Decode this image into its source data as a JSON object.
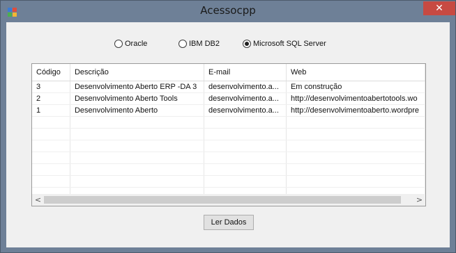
{
  "window": {
    "title": "Acessocpp",
    "close_glyph": "✕"
  },
  "db_options": [
    {
      "label": "Oracle",
      "checked": false
    },
    {
      "label": "IBM DB2",
      "checked": false
    },
    {
      "label": "Microsoft SQL Server",
      "checked": true
    }
  ],
  "grid": {
    "columns": [
      "Código",
      "Descrição",
      "E-mail",
      "Web"
    ],
    "rows": [
      [
        "3",
        "Desenvolvimento Aberto ERP -DA 3",
        "desenvolvimento.a...",
        "Em construção"
      ],
      [
        "2",
        "Desenvolvimento Aberto Tools",
        "desenvolvimento.a...",
        "http://desenvolvimentoabertotools.wo"
      ],
      [
        "1",
        "Desenvolvimento Aberto",
        "desenvolvimento.a...",
        "http://desenvolvimentoaberto.wordpre"
      ]
    ]
  },
  "scrollbar": {
    "left_arrow": "<",
    "right_arrow": ">"
  },
  "buttons": {
    "read": "Ler Dados"
  },
  "icons": {
    "app": "app-icon",
    "close": "close-icon"
  }
}
